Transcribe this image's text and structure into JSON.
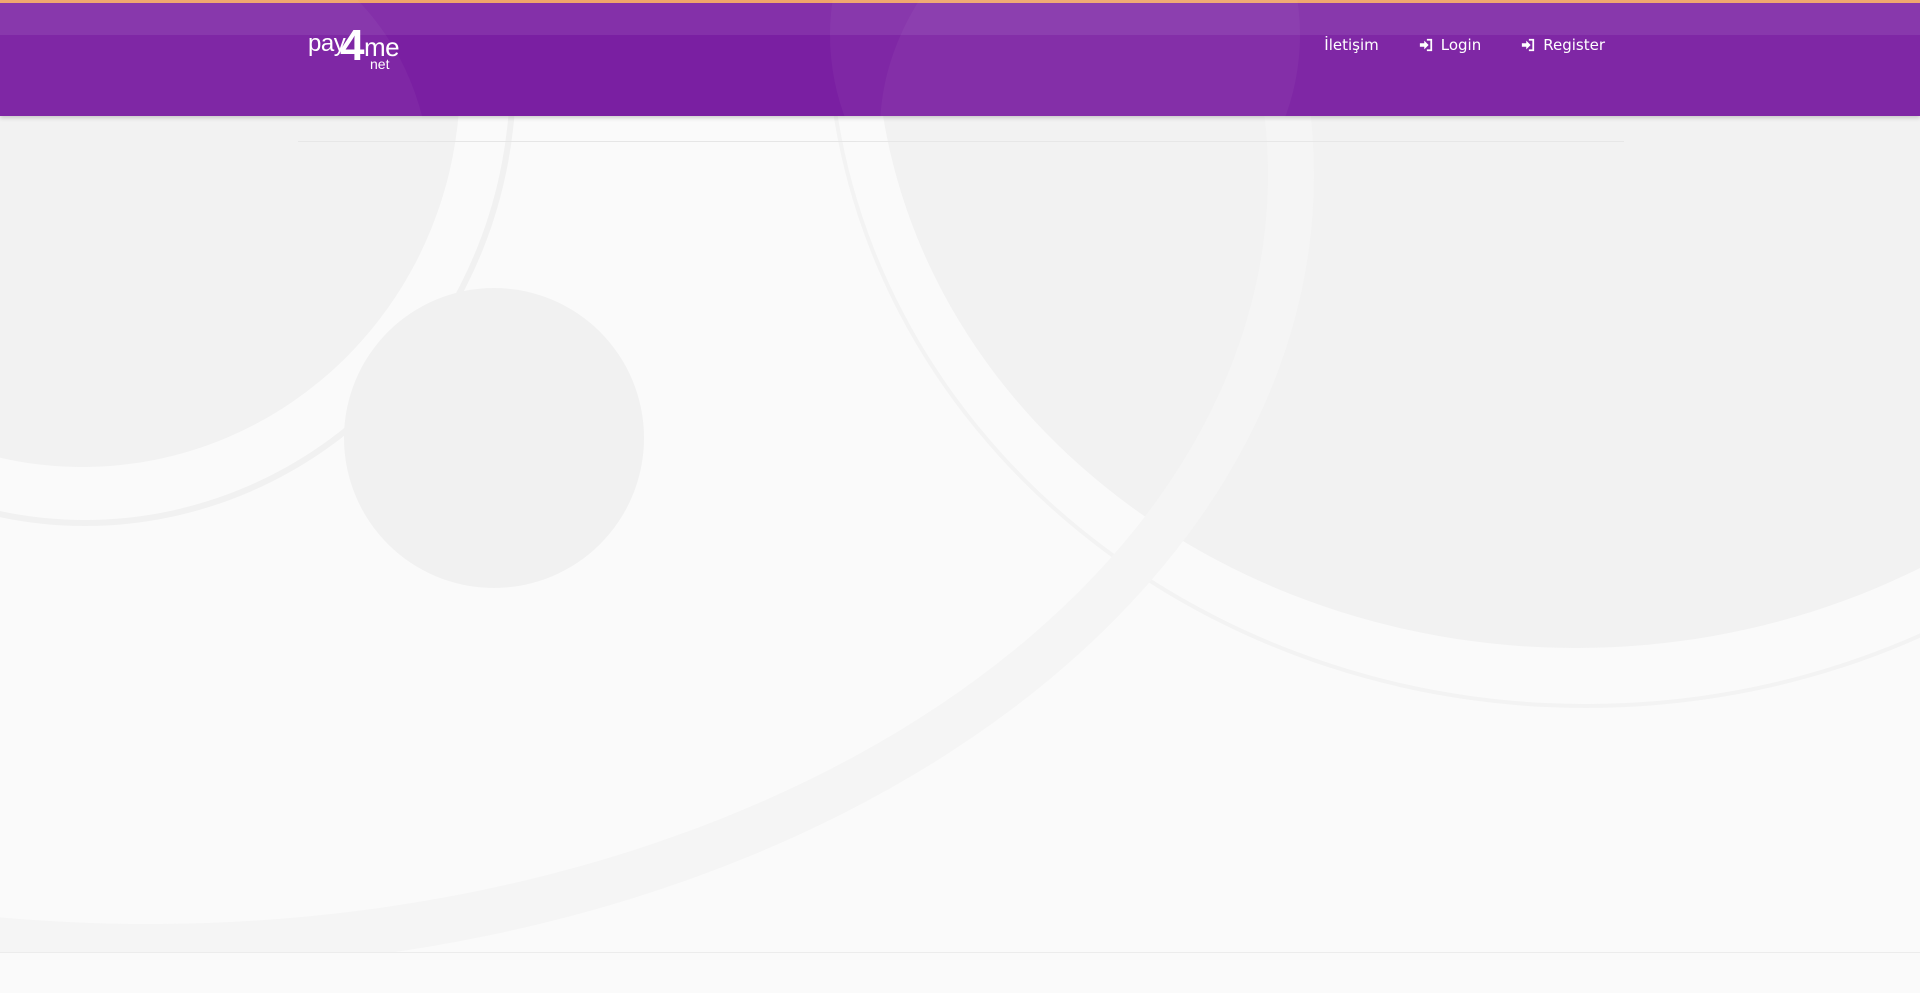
{
  "brand": {
    "logo_parts": {
      "pay": "pay",
      "four": "4",
      "me": "me",
      "net": "net"
    },
    "logo_alt": "pay4me.net"
  },
  "nav": {
    "items": [
      {
        "label": "İletişim",
        "icon": null
      },
      {
        "label": "Login",
        "icon": "sign-in-icon"
      },
      {
        "label": "Register",
        "icon": "sign-in-icon"
      }
    ]
  },
  "colors": {
    "header": "#7a1fa2",
    "accent": "#f0a46a",
    "background": "#fafafa"
  }
}
